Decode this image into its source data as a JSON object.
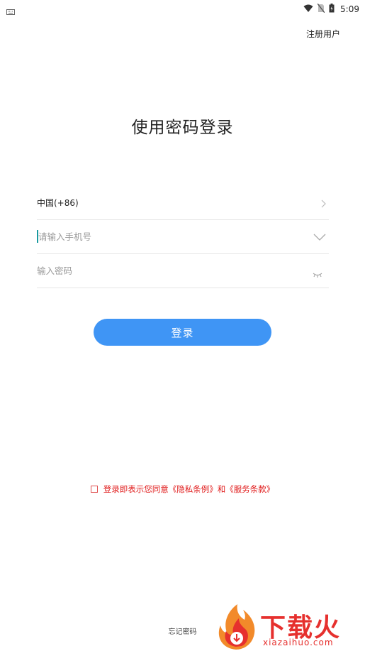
{
  "status_bar": {
    "time": "5:09",
    "icons": [
      "keyboard-icon",
      "wifi-icon",
      "no-sim-icon",
      "battery-icon"
    ]
  },
  "header": {
    "register_label": "注册用户"
  },
  "title": "使用密码登录",
  "form": {
    "country": "中国(+86)",
    "phone_placeholder": "请输入手机号",
    "password_placeholder": "输入密码",
    "icons": [
      "chevron-right-icon",
      "chevron-down-icon",
      "eye-closed-icon"
    ]
  },
  "login_button": "登录",
  "agreement": {
    "prefix": "登录即表示您同意",
    "privacy_link": "《隐私条例》",
    "conjunction": "和",
    "terms_link": "《服务条款》",
    "checked": false
  },
  "forgot_password": "忘记密码",
  "watermark": {
    "text": "下载火",
    "url": "xiazaihuo.com"
  },
  "colors": {
    "accent": "#3f95f5",
    "agreement_red": "#e01818",
    "caret": "#1a9aa0"
  }
}
